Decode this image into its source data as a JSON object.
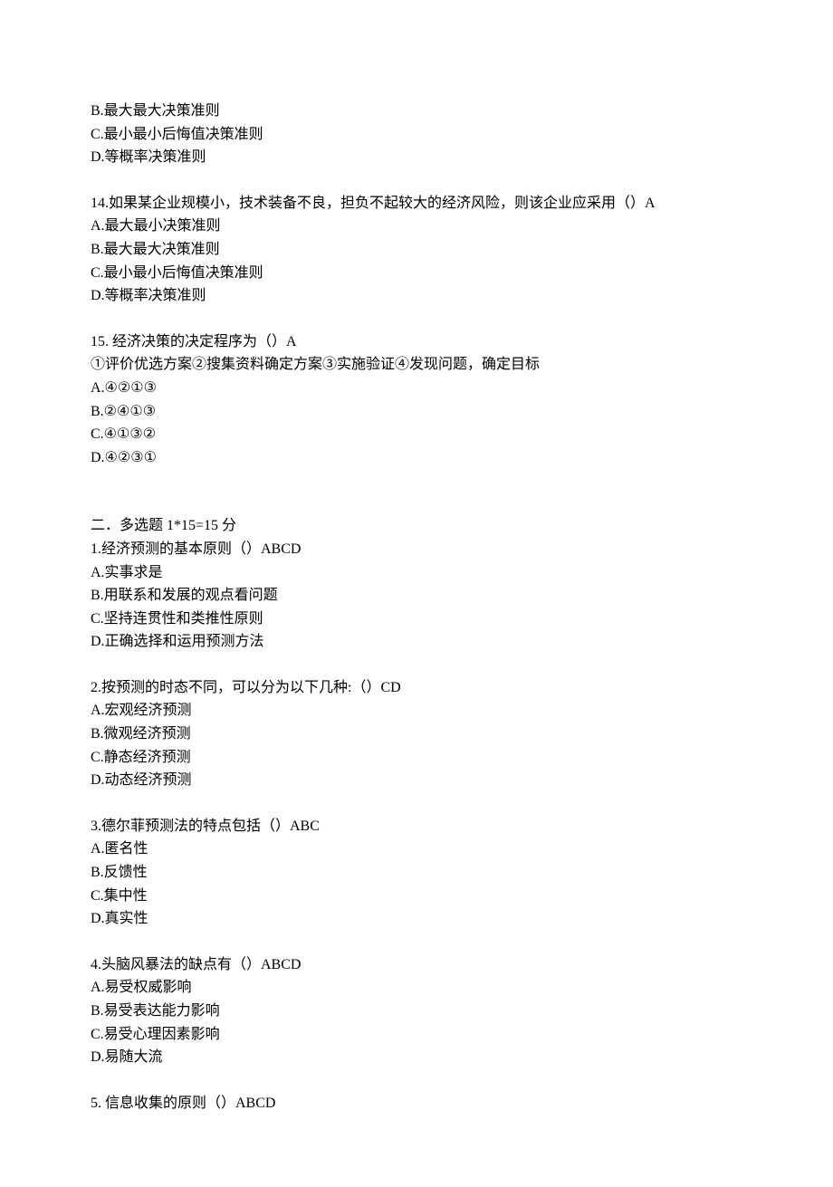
{
  "q13_partial": {
    "options": [
      "B.最大最大决策准则",
      "C.最小最小后悔值决策准则",
      "D.等概率决策准则"
    ]
  },
  "q14": {
    "stem": "14.如果某企业规模小，技术装备不良，担负不起较大的经济风险，则该企业应采用（）A",
    "options": [
      "A.最大最小决策准则",
      "B.最大最大决策准则",
      "C.最小最小后悔值决策准则",
      "D.等概率决策准则"
    ]
  },
  "q15": {
    "stem": "15. 经济决策的决定程序为（）A",
    "note": "①评价优选方案②搜集资料确定方案③实施验证④发现问题，确定目标",
    "options": [
      "A.④②①③",
      "B.②④①③",
      "C.④①③②",
      "D.④②③①"
    ]
  },
  "section2_title": "二．多选题  1*15=15 分",
  "mq1": {
    "stem": "1.经济预测的基本原则（）ABCD",
    "options": [
      "A.实事求是",
      "B.用联系和发展的观点看问题",
      "C.坚持连贯性和类推性原则",
      "D.正确选择和运用预测方法"
    ]
  },
  "mq2": {
    "stem": "2.按预测的时态不同，可以分为以下几种:（）CD",
    "options": [
      "A.宏观经济预测",
      "B.微观经济预测",
      "C.静态经济预测",
      "D.动态经济预测"
    ]
  },
  "mq3": {
    "stem": "3.德尔菲预测法的特点包括（）ABC",
    "options": [
      "A.匿名性",
      "B.反馈性",
      "C.集中性",
      "D.真实性"
    ]
  },
  "mq4": {
    "stem": "4.头脑风暴法的缺点有（）ABCD",
    "options": [
      "A.易受权威影响",
      "B.易受表达能力影响",
      "C.易受心理因素影响",
      "D.易随大流"
    ]
  },
  "mq5": {
    "stem": "5. 信息收集的原则（）ABCD"
  }
}
